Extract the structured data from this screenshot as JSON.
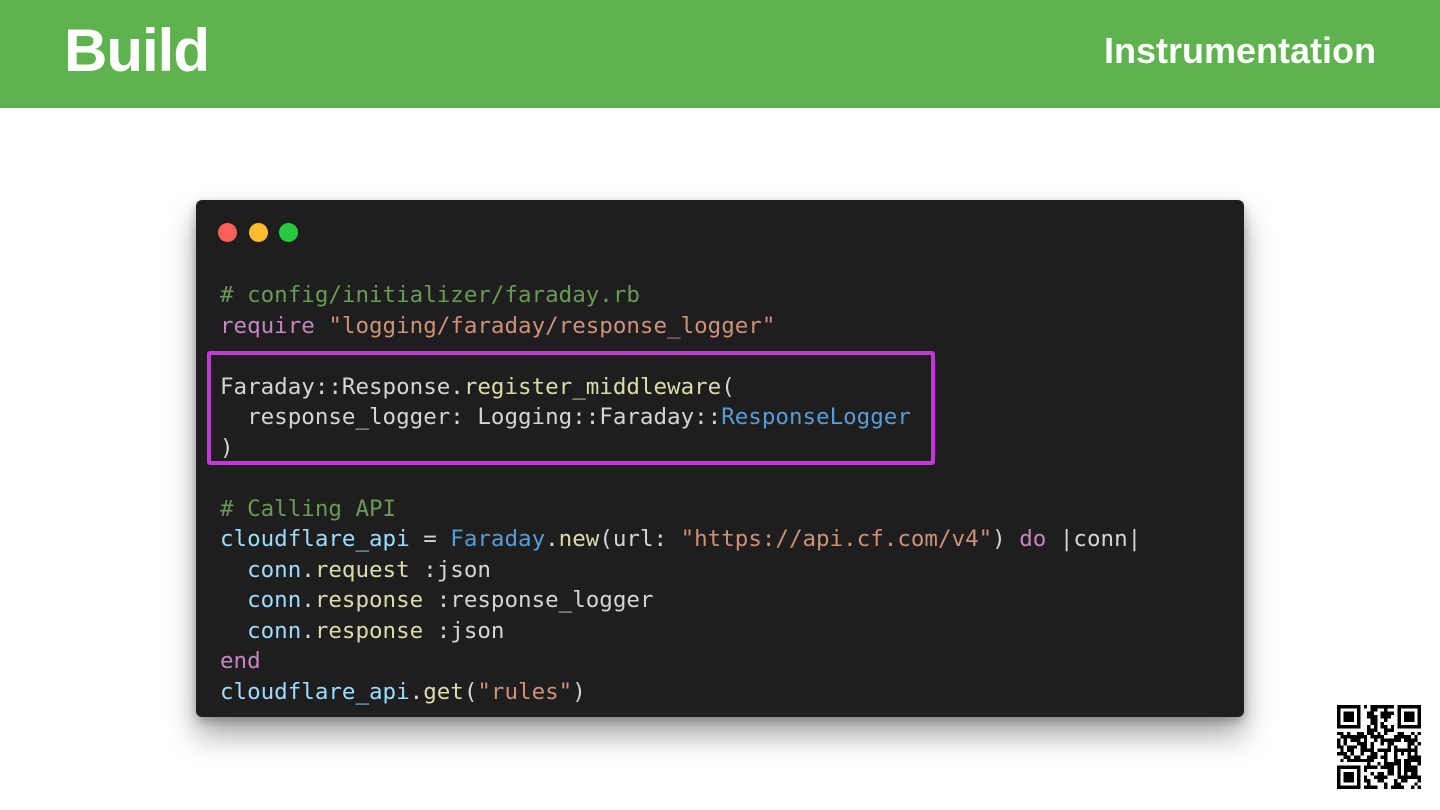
{
  "header": {
    "title": "Build",
    "section": "Instrumentation",
    "background_color": "#5fb34e"
  },
  "code_window": {
    "traffic_lights": [
      "close",
      "minimize",
      "maximize"
    ],
    "highlight_color": "#c13ad6",
    "lines": [
      [
        {
          "t": "# config/initializer/faraday.rb",
          "k": "comment"
        }
      ],
      [
        {
          "t": "require",
          "k": "keyword"
        },
        {
          "t": " ",
          "k": "plain"
        },
        {
          "t": "\"logging/faraday/response_logger\"",
          "k": "string"
        }
      ],
      [
        {
          "t": "",
          "k": "plain"
        }
      ],
      [
        {
          "t": "Faraday::Response.",
          "k": "plain"
        },
        {
          "t": "register_middleware",
          "k": "func"
        },
        {
          "t": "(",
          "k": "plain"
        }
      ],
      [
        {
          "t": "  response_logger: Logging::Faraday::",
          "k": "plain"
        },
        {
          "t": "ResponseLogger",
          "k": "class"
        }
      ],
      [
        {
          "t": ")",
          "k": "plain"
        }
      ],
      [
        {
          "t": "",
          "k": "plain"
        }
      ],
      [
        {
          "t": "# Calling API",
          "k": "comment"
        }
      ],
      [
        {
          "t": "cloudflare_api",
          "k": "var"
        },
        {
          "t": " = ",
          "k": "plain"
        },
        {
          "t": "Faraday",
          "k": "class"
        },
        {
          "t": ".",
          "k": "plain"
        },
        {
          "t": "new",
          "k": "func"
        },
        {
          "t": "(url: ",
          "k": "plain"
        },
        {
          "t": "\"https://api.cf.com/v4\"",
          "k": "string"
        },
        {
          "t": ") ",
          "k": "plain"
        },
        {
          "t": "do",
          "k": "keyword"
        },
        {
          "t": " |conn|",
          "k": "plain"
        }
      ],
      [
        {
          "t": "  ",
          "k": "plain"
        },
        {
          "t": "conn",
          "k": "var"
        },
        {
          "t": ".",
          "k": "plain"
        },
        {
          "t": "request",
          "k": "func"
        },
        {
          "t": " :json",
          "k": "plain"
        }
      ],
      [
        {
          "t": "  ",
          "k": "plain"
        },
        {
          "t": "conn",
          "k": "var"
        },
        {
          "t": ".",
          "k": "plain"
        },
        {
          "t": "response",
          "k": "func"
        },
        {
          "t": " :response_logger",
          "k": "plain"
        }
      ],
      [
        {
          "t": "  ",
          "k": "plain"
        },
        {
          "t": "conn",
          "k": "var"
        },
        {
          "t": ".",
          "k": "plain"
        },
        {
          "t": "response",
          "k": "func"
        },
        {
          "t": " :json",
          "k": "plain"
        }
      ],
      [
        {
          "t": "end",
          "k": "keyword"
        }
      ],
      [
        {
          "t": "cloudflare_api",
          "k": "var"
        },
        {
          "t": ".",
          "k": "plain"
        },
        {
          "t": "get",
          "k": "func"
        },
        {
          "t": "(",
          "k": "plain"
        },
        {
          "t": "\"rules\"",
          "k": "string"
        },
        {
          "t": ")",
          "k": "plain"
        }
      ]
    ]
  },
  "qr_code": {
    "icon": "qr-code-icon"
  }
}
